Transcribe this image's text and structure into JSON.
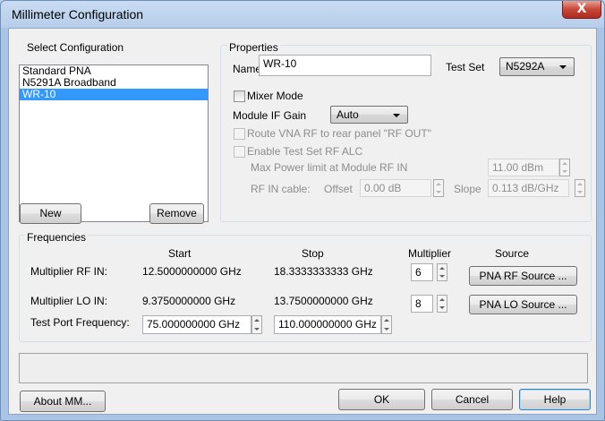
{
  "window": {
    "title": "Millimeter Configuration",
    "close_label": "X"
  },
  "select_configuration": {
    "heading": "Select Configuration",
    "items": [
      {
        "label": "Standard PNA",
        "selected": false
      },
      {
        "label": "N5291A Broadband",
        "selected": false
      },
      {
        "label": "WR-10",
        "selected": true
      }
    ],
    "new_label": "New",
    "remove_label": "Remove"
  },
  "properties": {
    "heading": "Properties",
    "name_label": "Name",
    "name_value": "WR-10",
    "test_set_label": "Test Set",
    "test_set_value": "N5292A",
    "mixer_mode_label": "Mixer Mode",
    "module_if_gain_label": "Module IF Gain",
    "module_if_gain_value": "Auto",
    "route_label": "Route VNA RF to rear panel \"RF OUT\"",
    "enable_alc_label": "Enable Test Set RF ALC",
    "max_power_label": "Max Power limit at Module RF IN",
    "max_power_value": "11.00 dBm",
    "rf_in_cable_label": "RF IN cable:",
    "offset_label": "Offset",
    "offset_value": "0.00 dB",
    "slope_label": "Slope",
    "slope_value": "0.113 dB/GHz"
  },
  "frequencies": {
    "heading": "Frequencies",
    "col_start": "Start",
    "col_stop": "Stop",
    "col_multiplier": "Multiplier",
    "col_source": "Source",
    "rf_in": {
      "label": "Multiplier RF IN:",
      "start": "12.5000000000 GHz",
      "stop": "18.3333333333 GHz",
      "multiplier": "6",
      "source_label": "PNA RF Source ..."
    },
    "lo_in": {
      "label": "Multiplier LO IN:",
      "start": "9.3750000000 GHz",
      "stop": "13.7500000000 GHz",
      "multiplier": "8",
      "source_label": "PNA LO Source ..."
    },
    "test_port": {
      "label": "Test Port Frequency:",
      "start": "75.000000000 GHz",
      "stop": "110.000000000 GHz"
    }
  },
  "footer": {
    "about_label": "About MM...",
    "ok_label": "OK",
    "cancel_label": "Cancel",
    "help_label": "Help"
  }
}
